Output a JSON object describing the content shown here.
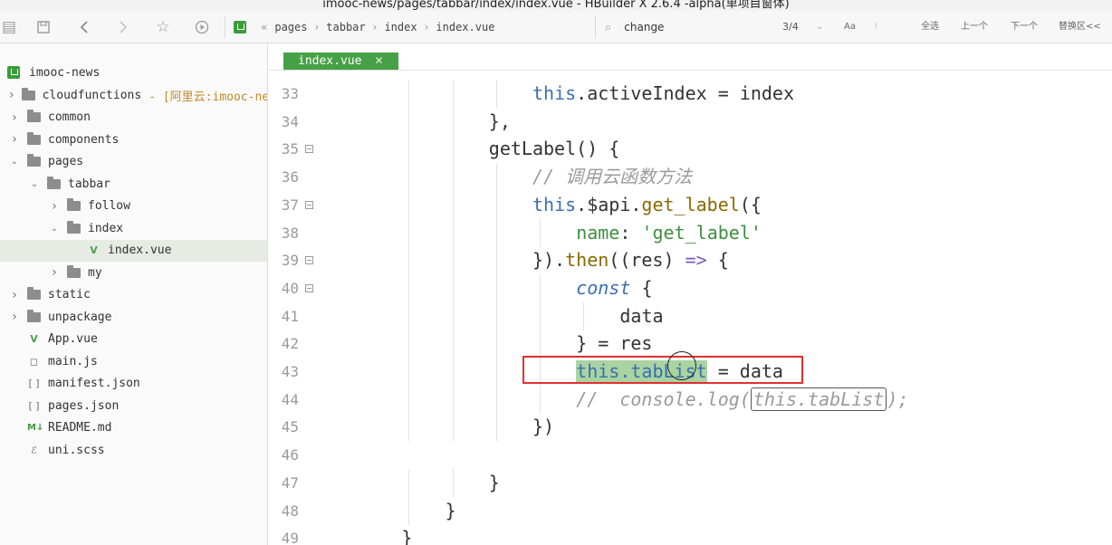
{
  "window": {
    "title": "imooc-news/pages/tabbar/index/index.vue - HBuilder X 2.6.4 -alpha(单项目窗体)"
  },
  "toolbar": {
    "breadcrumbs": [
      "pages",
      "tabbar",
      "index",
      "index.vue"
    ],
    "find_text": "change",
    "find_count": "3/4",
    "options": {
      "case": "Aa",
      "select_all": "全选",
      "prev": "上一个",
      "next": "下一个",
      "replace": "替换区<<"
    }
  },
  "sidebar": {
    "project": "imooc-news",
    "items": [
      {
        "label": "cloudfunctions",
        "note": "- [阿里云:imooc-news]",
        "kind": "folder",
        "depth": 1,
        "arrow": "right"
      },
      {
        "label": "common",
        "kind": "folder",
        "depth": 1,
        "arrow": "right"
      },
      {
        "label": "components",
        "kind": "folder",
        "depth": 1,
        "arrow": "right"
      },
      {
        "label": "pages",
        "kind": "folder",
        "depth": 1,
        "arrow": "down"
      },
      {
        "label": "tabbar",
        "kind": "folder",
        "depth": 2,
        "arrow": "down"
      },
      {
        "label": "follow",
        "kind": "folder",
        "depth": 3,
        "arrow": "right"
      },
      {
        "label": "index",
        "kind": "folder",
        "depth": 3,
        "arrow": "down"
      },
      {
        "label": "index.vue",
        "kind": "vue",
        "depth": 4,
        "arrow": "none",
        "selected": true
      },
      {
        "label": "my",
        "kind": "folder",
        "depth": 3,
        "arrow": "right"
      },
      {
        "label": "static",
        "kind": "folder",
        "depth": 1,
        "arrow": "right"
      },
      {
        "label": "unpackage",
        "kind": "folder",
        "depth": 1,
        "arrow": "right"
      },
      {
        "label": "App.vue",
        "kind": "vue",
        "depth": 1,
        "arrow": "none"
      },
      {
        "label": "main.js",
        "kind": "js",
        "depth": 1,
        "arrow": "none"
      },
      {
        "label": "manifest.json",
        "kind": "json",
        "depth": 1,
        "arrow": "none"
      },
      {
        "label": "pages.json",
        "kind": "json",
        "depth": 1,
        "arrow": "none"
      },
      {
        "label": "README.md",
        "kind": "md",
        "depth": 1,
        "arrow": "none"
      },
      {
        "label": "uni.scss",
        "kind": "scss",
        "depth": 1,
        "arrow": "none"
      }
    ]
  },
  "editor": {
    "tab_label": "index.vue",
    "lines": [
      {
        "n": "33",
        "indent": 5,
        "fold": false,
        "segments": [
          [
            "this",
            "kw-this"
          ],
          [
            ".activeIndex = index",
            ""
          ]
        ]
      },
      {
        "n": "34",
        "indent": 4,
        "fold": false,
        "segments": [
          [
            "},",
            ""
          ]
        ]
      },
      {
        "n": "35",
        "indent": 4,
        "fold": true,
        "segments": [
          [
            "getLabel() {",
            ""
          ]
        ]
      },
      {
        "n": "36",
        "indent": 5,
        "fold": false,
        "segments": [
          [
            "// 调用云函数方法",
            "cm"
          ]
        ]
      },
      {
        "n": "37",
        "indent": 5,
        "fold": true,
        "segments": [
          [
            "this",
            "kw-this"
          ],
          [
            ".$api.",
            ""
          ],
          [
            "get_label",
            "fn"
          ],
          [
            "({",
            ""
          ]
        ]
      },
      {
        "n": "38",
        "indent": 6,
        "fold": false,
        "segments": [
          [
            "name",
            "prop"
          ],
          [
            ": ",
            ""
          ],
          [
            "'get_label'",
            "str"
          ]
        ]
      },
      {
        "n": "39",
        "indent": 5,
        "fold": true,
        "segments": [
          [
            "}).",
            ""
          ],
          [
            "then",
            "fn"
          ],
          [
            "((res) ",
            ""
          ],
          [
            "=>",
            "arrow-op"
          ],
          [
            " {",
            ""
          ]
        ]
      },
      {
        "n": "40",
        "indent": 6,
        "fold": true,
        "segments": [
          [
            "const",
            "const"
          ],
          [
            " {",
            ""
          ]
        ]
      },
      {
        "n": "41",
        "indent": 7,
        "fold": false,
        "segments": [
          [
            "data",
            ""
          ]
        ]
      },
      {
        "n": "42",
        "indent": 6,
        "fold": false,
        "segments": [
          [
            "} = res",
            ""
          ]
        ]
      },
      {
        "n": "43",
        "indent": 6,
        "fold": false,
        "segments": [
          [
            "this.tabList",
            "kw-this hl"
          ],
          [
            " = data",
            ""
          ]
        ]
      },
      {
        "n": "44",
        "indent": 6,
        "fold": false,
        "segments": [
          [
            "//  console.log(",
            "cm"
          ],
          [
            "this.tabList",
            "cm match-box"
          ],
          [
            ");",
            "cm"
          ]
        ]
      },
      {
        "n": "45",
        "indent": 5,
        "fold": false,
        "segments": [
          [
            "})",
            ""
          ]
        ]
      },
      {
        "n": "46",
        "indent": 0,
        "fold": false,
        "segments": []
      },
      {
        "n": "47",
        "indent": 4,
        "fold": false,
        "segments": [
          [
            "}",
            ""
          ]
        ]
      },
      {
        "n": "48",
        "indent": 3,
        "fold": false,
        "segments": [
          [
            "}",
            ""
          ]
        ]
      },
      {
        "n": "49",
        "indent": 2,
        "fold": false,
        "segments": [
          [
            "}",
            ""
          ]
        ]
      }
    ]
  }
}
